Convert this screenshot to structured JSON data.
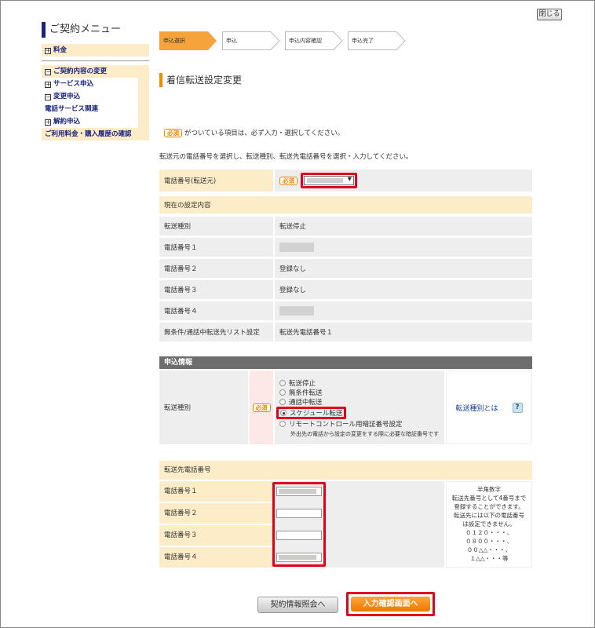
{
  "header": {
    "close_label": "閉じる"
  },
  "sidebar": {
    "title": "ご契約メニュー",
    "items": [
      {
        "label": "料金",
        "toggle": "⊞"
      },
      {
        "label": "ご契約内容の変更",
        "toggle": "⊟"
      },
      {
        "label": "サービス申込",
        "toggle": "⊞"
      },
      {
        "label": "変更申込",
        "toggle": "⊟"
      },
      {
        "label": "電話サービス関連",
        "toggle": ""
      },
      {
        "label": "解約申込",
        "toggle": "⊞"
      },
      {
        "label": "ご利用料金・購入履歴の確認",
        "toggle": ""
      }
    ]
  },
  "steps": [
    "申込選択",
    "申込",
    "申込内容確認",
    "申込完了"
  ],
  "page_title": "着信転送設定変更",
  "required_badge": "必須",
  "notes": {
    "required_note": "がついている項目は、必ず入力・選択してください。",
    "instruction": "転送元の電話番号を選択し、転送種別、転送先電話番号を選択・入力してください。"
  },
  "source_phone": {
    "label": "電話番号(転送元)"
  },
  "current_settings": {
    "header": "現在の設定内容",
    "rows": [
      {
        "label": "転送種別",
        "value": "転送停止"
      },
      {
        "label": "電話番号１",
        "value": ""
      },
      {
        "label": "電話番号２",
        "value": "登録なし"
      },
      {
        "label": "電話番号３",
        "value": "登録なし"
      },
      {
        "label": "電話番号４",
        "value": ""
      },
      {
        "label": "無条件/通話中転送先リスト設定",
        "value": "転送先電話番号１"
      }
    ]
  },
  "application": {
    "header": "申込情報",
    "type_label": "転送種別",
    "options": [
      "転送停止",
      "無条件転送",
      "通話中転送",
      "スケジュール転送",
      "リモートコントロール用暗証番号設定"
    ],
    "selected_option": "スケジュール転送",
    "option_note": "外出先の電話から設定の変更をする際に必要な暗証番号です",
    "help_link": "転送種別とは",
    "help_icon": "?"
  },
  "forward_numbers": {
    "header": "転送先電話番号",
    "labels": [
      "電話番号１",
      "電話番号２",
      "電話番号３",
      "電話番号４"
    ],
    "note_lines": [
      "半角数字",
      "転送先番号として4番号まで",
      "登録することができます。",
      "転送先には以下の電話番号",
      "は設定できません。",
      "０１２０・・・、",
      "０８００・・・、",
      "００△△・・・、",
      "１△△・・・等"
    ]
  },
  "buttons": {
    "back": "契約情報照会へ",
    "confirm": "入力確認画面へ"
  }
}
